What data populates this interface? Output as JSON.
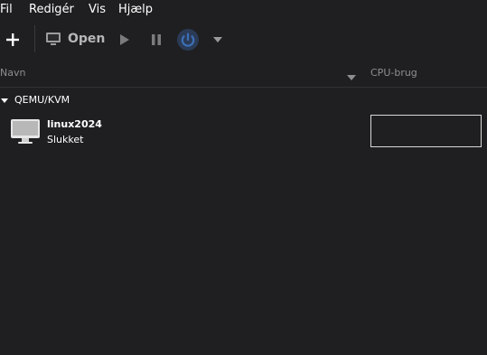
{
  "menubar": {
    "items": [
      "Fil",
      "Redigér",
      "Vis",
      "Hjælp"
    ]
  },
  "toolbar": {
    "new_icon": "plus-icon",
    "open_icon": "monitor-icon",
    "open_label": "Open",
    "run_icon": "play-icon",
    "pause_icon": "pause-icon",
    "shutdown_icon": "power-icon",
    "shutdown_menu_icon": "chevron-down-icon",
    "accent_color": "#3c6fb5"
  },
  "list_header": {
    "name_label": "Navn",
    "cpu_label": "CPU-brug"
  },
  "connections": [
    {
      "name": "QEMU/KVM",
      "vms": [
        {
          "name": "linux2024",
          "status": "Slukket",
          "icon": "monitor-icon"
        }
      ]
    }
  ]
}
